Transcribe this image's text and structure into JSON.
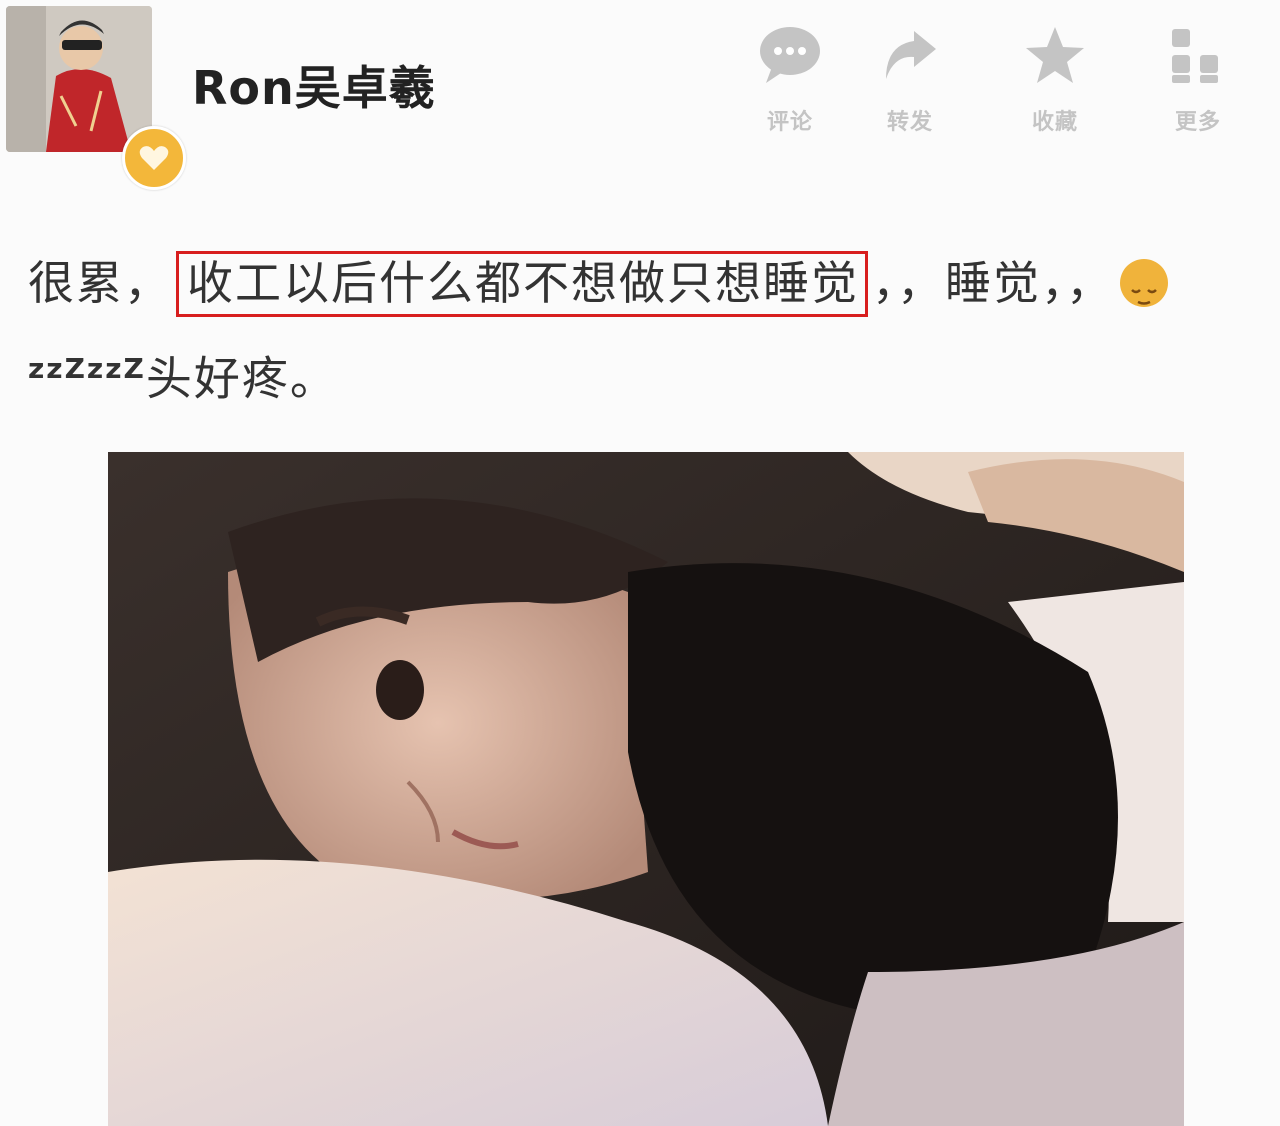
{
  "header": {
    "username": "Ron吴卓羲",
    "actions": [
      {
        "label": "评论",
        "icon": "comment-icon"
      },
      {
        "label": "转发",
        "icon": "forward-icon"
      },
      {
        "label": "收藏",
        "icon": "star-icon"
      },
      {
        "label": "更多",
        "icon": "more-grid-icon"
      }
    ]
  },
  "post": {
    "text_before": "很累，",
    "text_highlight": "收工以后什么都不想做只想睡觉",
    "text_after": "，，睡觉，，",
    "zzz1": "zzZ",
    "zzz2": "zzZ",
    "text_end": "头好疼。"
  },
  "colors": {
    "highlight_border": "#d81e1e",
    "badge": "#f3b73a",
    "icon_gray": "#c4c4c4"
  }
}
